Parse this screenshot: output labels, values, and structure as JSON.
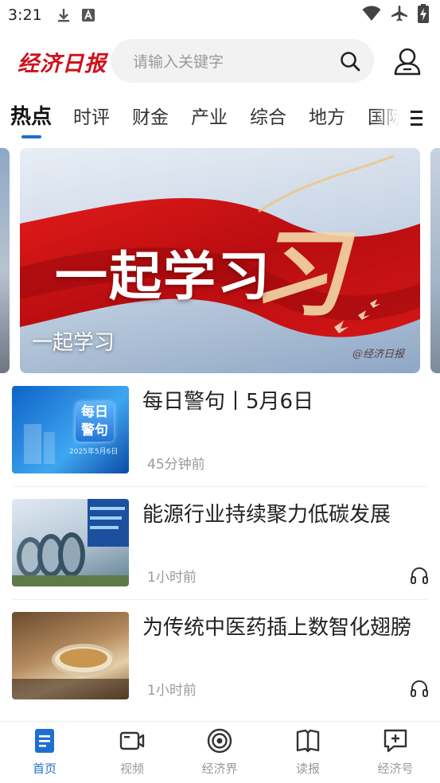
{
  "status_bar": {
    "time": "3:21"
  },
  "header": {
    "logo_text": "经济日报",
    "search_placeholder": "请输入关键字"
  },
  "tabs": [
    {
      "label": "热点",
      "active": true
    },
    {
      "label": "时评"
    },
    {
      "label": "财金"
    },
    {
      "label": "产业"
    },
    {
      "label": "综合"
    },
    {
      "label": "地方"
    },
    {
      "label": "国际"
    }
  ],
  "banner": {
    "hero_text": "一起学习",
    "caption": "一起学习",
    "watermark": "@经济日报"
  },
  "news": [
    {
      "title": "每日警句丨5月6日",
      "time": "45分钟前",
      "thumb_text": "每日警句",
      "thumb_date": "2025年5月6日",
      "has_audio": false
    },
    {
      "title": "能源行业持续聚力低碳发展",
      "time": "1小时前",
      "has_audio": true
    },
    {
      "title": "为传统中医药插上数智化翅膀",
      "time": "1小时前",
      "has_audio": true
    }
  ],
  "bottom_nav": [
    {
      "label": "首页",
      "icon": "home-doc-icon",
      "active": true
    },
    {
      "label": "视频",
      "icon": "video-icon"
    },
    {
      "label": "经济界",
      "icon": "target-icon"
    },
    {
      "label": "读报",
      "icon": "book-icon"
    },
    {
      "label": "经济号",
      "icon": "add-note-icon"
    }
  ],
  "colors": {
    "accent": "#1f6fd3",
    "brand_red": "#d0101b"
  }
}
